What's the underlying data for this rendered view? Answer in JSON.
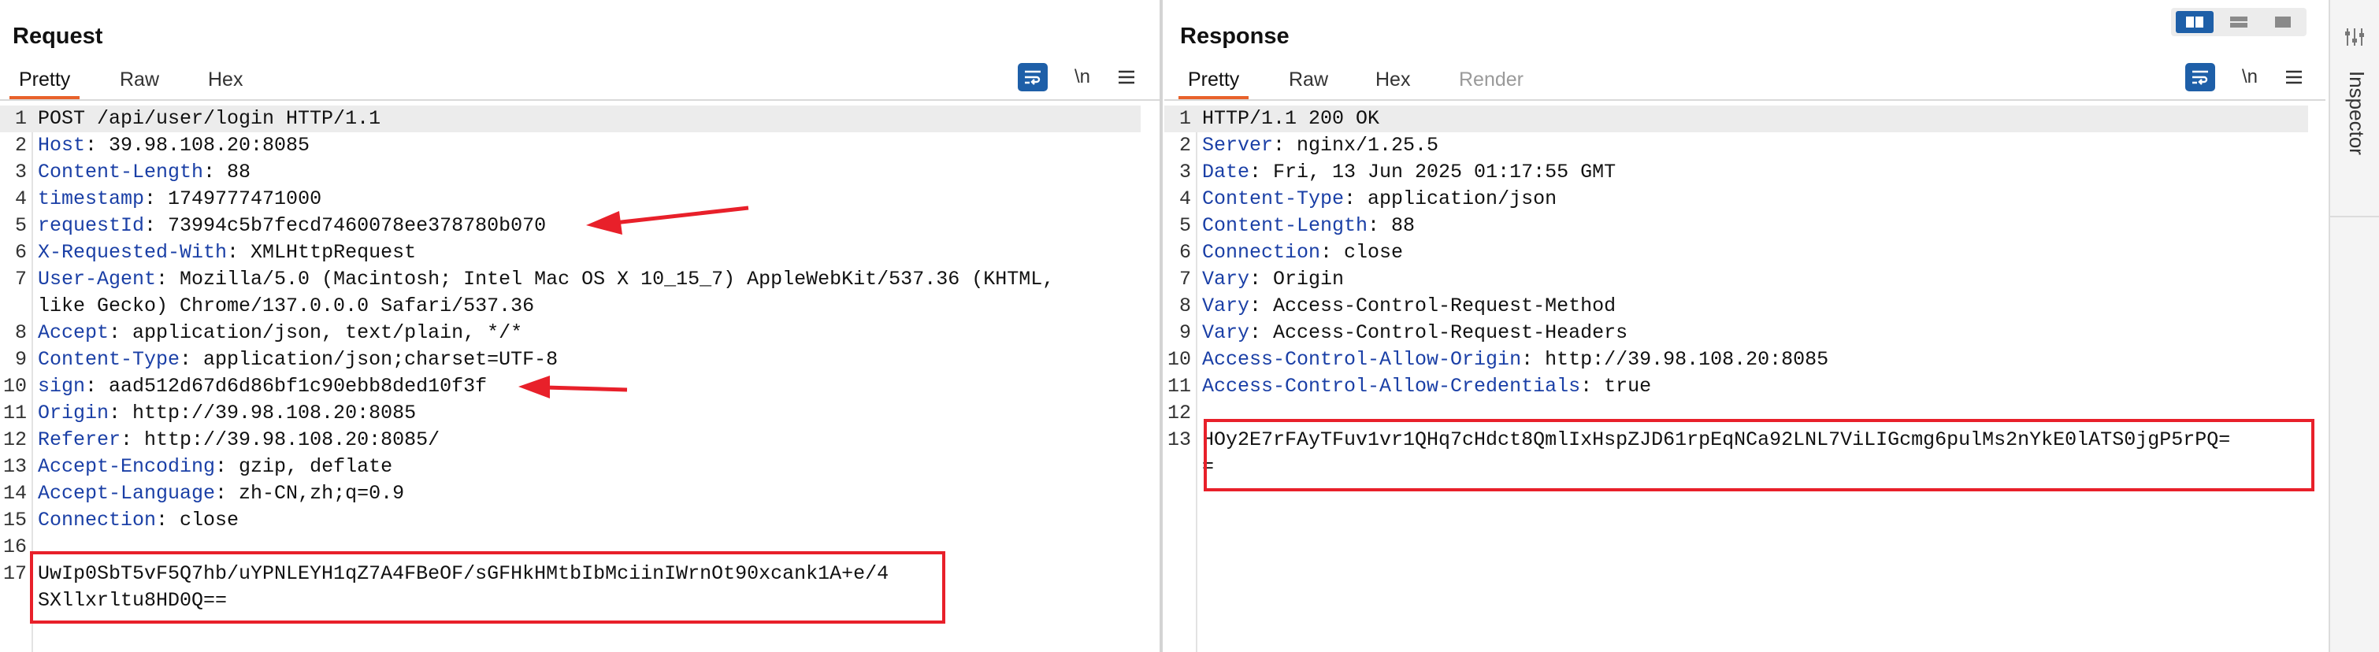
{
  "request": {
    "title": "Request",
    "tabs": [
      "Pretty",
      "Raw",
      "Hex"
    ],
    "active_tab": "Pretty",
    "newline_toggle": "\\n",
    "lines": [
      {
        "n": "1",
        "k": "",
        "v": "POST /api/user/login HTTP/1.1"
      },
      {
        "n": "2",
        "k": "Host",
        "v": ": 39.98.108.20:8085"
      },
      {
        "n": "3",
        "k": "Content-Length",
        "v": ": 88"
      },
      {
        "n": "4",
        "k": "timestamp",
        "v": ": 1749777471000"
      },
      {
        "n": "5",
        "k": "requestId",
        "v": ": 73994c5b7fecd7460078ee378780b070"
      },
      {
        "n": "6",
        "k": "X-Requested-With",
        "v": ": XMLHttpRequest"
      },
      {
        "n": "7",
        "k": "User-Agent",
        "v": ": Mozilla/5.0 (Macintosh; Intel Mac OS X 10_15_7) AppleWebKit/537.36 (KHTML,"
      },
      {
        "n": "",
        "k": "",
        "v": "like Gecko) Chrome/137.0.0.0 Safari/537.36"
      },
      {
        "n": "8",
        "k": "Accept",
        "v": ": application/json, text/plain, */*"
      },
      {
        "n": "9",
        "k": "Content-Type",
        "v": ": application/json;charset=UTF-8"
      },
      {
        "n": "10",
        "k": "sign",
        "v": ": aad512d67d6d86bf1c90ebb8ded10f3f"
      },
      {
        "n": "11",
        "k": "Origin",
        "v": ": http://39.98.108.20:8085"
      },
      {
        "n": "12",
        "k": "Referer",
        "v": ": http://39.98.108.20:8085/"
      },
      {
        "n": "13",
        "k": "Accept-Encoding",
        "v": ": gzip, deflate"
      },
      {
        "n": "14",
        "k": "Accept-Language",
        "v": ": zh-CN,zh;q=0.9"
      },
      {
        "n": "15",
        "k": "Connection",
        "v": ": close"
      },
      {
        "n": "16",
        "k": "",
        "v": ""
      },
      {
        "n": "17",
        "k": "",
        "v": "UwIp0SbT5vF5Q7hb/uYPNLEYH1qZ7A4FBeOF/sGFHkHMtbIbMciinIWrnOt90xcank1A+e/4"
      },
      {
        "n": "",
        "k": "",
        "v": "SXllxrltu8HD0Q=="
      }
    ]
  },
  "response": {
    "title": "Response",
    "tabs": [
      "Pretty",
      "Raw",
      "Hex",
      "Render"
    ],
    "active_tab": "Pretty",
    "newline_toggle": "\\n",
    "lines": [
      {
        "n": "1",
        "k": "",
        "v": "HTTP/1.1 200 OK"
      },
      {
        "n": "2",
        "k": "Server",
        "v": ": nginx/1.25.5"
      },
      {
        "n": "3",
        "k": "Date",
        "v": ": Fri, 13 Jun 2025 01:17:55 GMT"
      },
      {
        "n": "4",
        "k": "Content-Type",
        "v": ": application/json"
      },
      {
        "n": "5",
        "k": "Content-Length",
        "v": ": 88"
      },
      {
        "n": "6",
        "k": "Connection",
        "v": ": close"
      },
      {
        "n": "7",
        "k": "Vary",
        "v": ": Origin"
      },
      {
        "n": "8",
        "k": "Vary",
        "v": ": Access-Control-Request-Method"
      },
      {
        "n": "9",
        "k": "Vary",
        "v": ": Access-Control-Request-Headers"
      },
      {
        "n": "10",
        "k": "Access-Control-Allow-Origin",
        "v": ": http://39.98.108.20:8085"
      },
      {
        "n": "11",
        "k": "Access-Control-Allow-Credentials",
        "v": ": true"
      },
      {
        "n": "12",
        "k": "",
        "v": ""
      },
      {
        "n": "13",
        "k": "",
        "v": "HOy2E7rFAyTFuv1vr1QHq7cHdct8QmlIxHspZJD61rpEqNCa92LNL7ViLIGcmg6pulMs2nYkE0lATS0jgP5rPQ="
      },
      {
        "n": "",
        "k": "",
        "v": "="
      }
    ]
  },
  "inspector": {
    "label": "Inspector"
  },
  "colors": {
    "accent_tab": "#e8622b",
    "header_key": "#1a3fa6",
    "highlight_box": "#e8202a",
    "wrap_button": "#1e5fa8",
    "layout_active": "#1e5fa8"
  },
  "icons": [
    "wrap-lines-icon",
    "menu-icon",
    "layout-columns-icon",
    "layout-rows-icon",
    "layout-tabs-icon",
    "inspector-settings-icon",
    "arrow-annotation-icon"
  ]
}
